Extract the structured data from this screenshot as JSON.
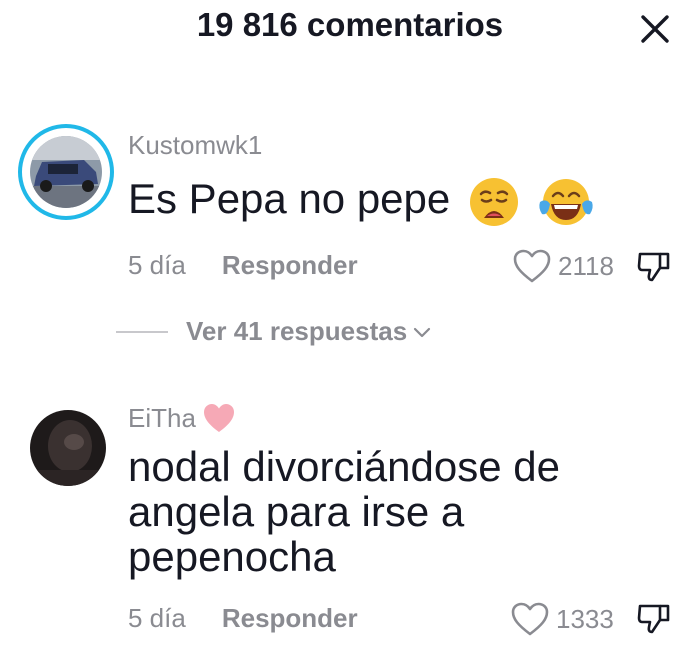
{
  "header": {
    "title": "19 816 comentarios"
  },
  "comments": [
    {
      "username": "Kustomwk1",
      "text": "Es Pepa no pepe",
      "emojis": [
        "weary-face-emoji",
        "tears-of-joy-emoji"
      ],
      "date": "5 día",
      "reply_label": "Responder",
      "likes": "2118",
      "view_replies": "Ver 41 respuestas"
    },
    {
      "username": "EiTha",
      "username_badge": "pink-heart-icon",
      "text": "nodal divorciándose de angela para irse a pepenocha",
      "date": "5 día",
      "reply_label": "Responder",
      "likes": "1333"
    }
  ],
  "icons": [
    "close-icon",
    "heart-outline-icon",
    "dislike-icon",
    "chevron-down-icon"
  ]
}
